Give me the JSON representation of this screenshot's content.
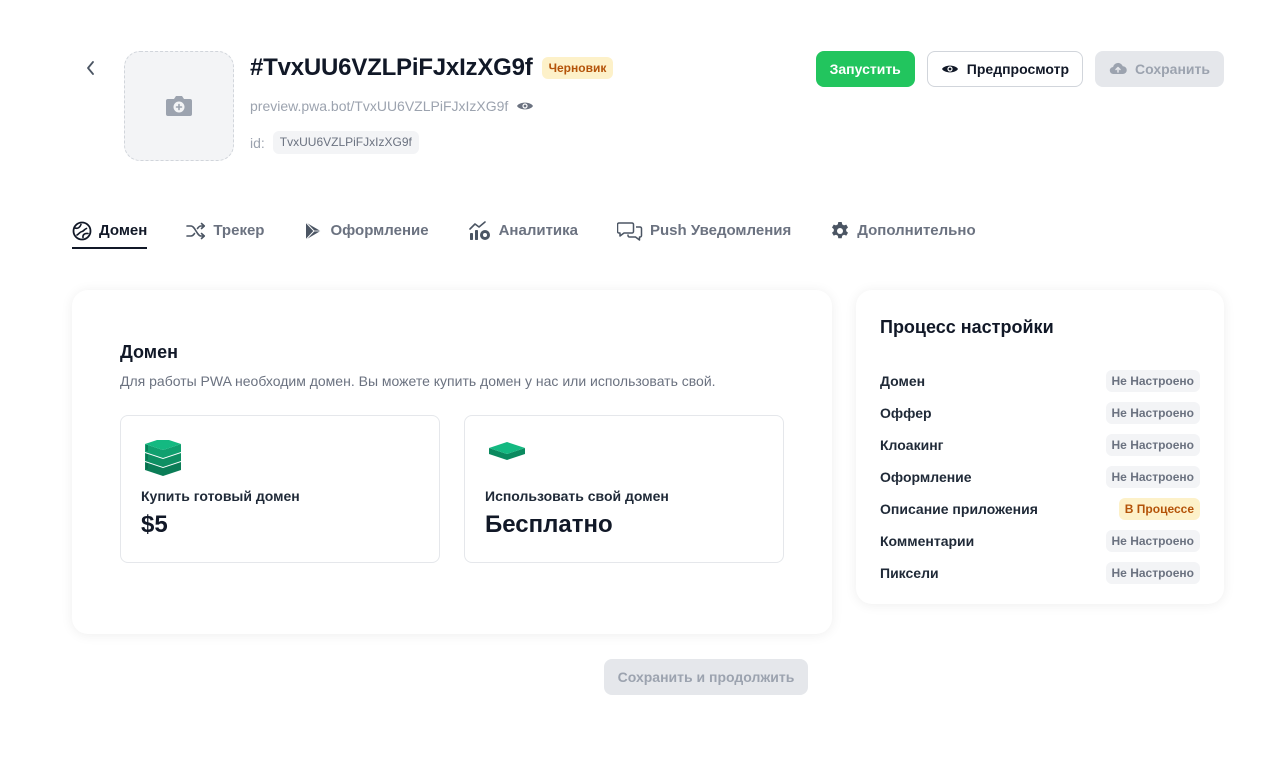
{
  "header": {
    "title": "#TvxUU6VZLPiFJxIzXG9f",
    "status_badge": "Черновик",
    "preview_url": "preview.pwa.bot/TvxUU6VZLPiFJxIzXG9f",
    "id_label": "id:",
    "id_value": "TvxUU6VZLPiFJxIzXG9f"
  },
  "actions": {
    "launch": "Запустить",
    "preview": "Предпросмотр",
    "save": "Сохранить"
  },
  "tabs": [
    {
      "label": "Домен",
      "icon": "globe-icon",
      "active": true
    },
    {
      "label": "Трекер",
      "icon": "shuffle-icon",
      "active": false
    },
    {
      "label": "Оформление",
      "icon": "play-store-icon",
      "active": false
    },
    {
      "label": "Аналитика",
      "icon": "analytics-icon",
      "active": false
    },
    {
      "label": "Push Уведомления",
      "icon": "chat-icon",
      "active": false
    },
    {
      "label": "Дополнительно",
      "icon": "gear-icon",
      "active": false
    }
  ],
  "domain_section": {
    "title": "Домен",
    "description": "Для работы PWA необходим домен. Вы можете купить домен у нас или использовать свой.",
    "options": [
      {
        "title": "Купить готовый домен",
        "price": "$5",
        "icon": "server-stack-icon"
      },
      {
        "title": "Использовать свой домен",
        "price": "Бесплатно",
        "icon": "layer-icon"
      }
    ],
    "continue_button": "Сохранить и продолжить"
  },
  "setup_process": {
    "title": "Процесс настройки",
    "steps": [
      {
        "label": "Домен",
        "status": "Не Настроено",
        "state": "not-set"
      },
      {
        "label": "Оффер",
        "status": "Не Настроено",
        "state": "not-set"
      },
      {
        "label": "Клоакинг",
        "status": "Не Настроено",
        "state": "not-set"
      },
      {
        "label": "Оформление",
        "status": "Не Настроено",
        "state": "not-set"
      },
      {
        "label": "Описание приложения",
        "status": "В Процессе",
        "state": "in-progress"
      },
      {
        "label": "Комментарии",
        "status": "Не Настроено",
        "state": "not-set"
      },
      {
        "label": "Пиксели",
        "status": "Не Настроено",
        "state": "not-set"
      }
    ]
  },
  "colors": {
    "accent_green": "#22c55e",
    "icon_green": "#0f9e6e",
    "badge_yellow_bg": "#fdf1c9",
    "badge_yellow_text": "#b45309"
  }
}
